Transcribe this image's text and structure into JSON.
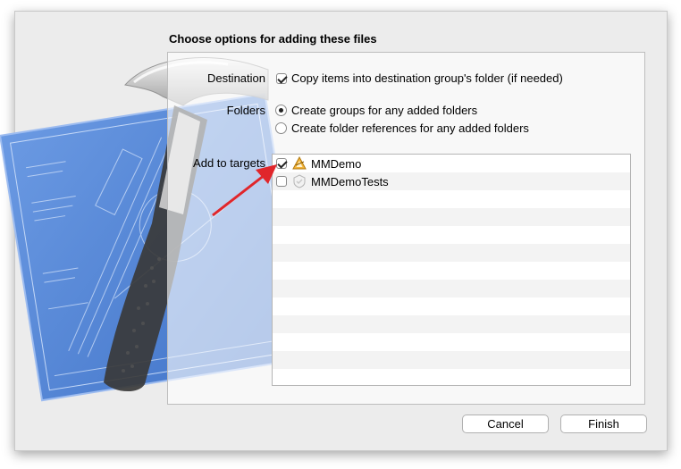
{
  "dialog": {
    "title": "Choose options for adding these files"
  },
  "destination": {
    "label": "Destination",
    "option": "Copy items into destination group's folder (if needed)",
    "checked": true
  },
  "folders": {
    "label": "Folders",
    "options": [
      {
        "label": "Create groups for any added folders",
        "selected": true
      },
      {
        "label": "Create folder references for any added folders",
        "selected": false
      }
    ]
  },
  "targets": {
    "label": "Add to targets",
    "items": [
      {
        "name": "MMDemo",
        "checked": true,
        "icon": "app-target-icon"
      },
      {
        "name": "MMDemoTests",
        "checked": false,
        "icon": "test-target-icon"
      }
    ]
  },
  "buttons": {
    "cancel": "Cancel",
    "finish": "Finish"
  },
  "colors": {
    "blueprint": "#4a7fd1",
    "arrow": "#e0262b",
    "hammer_handle": "#3a3a3a"
  }
}
